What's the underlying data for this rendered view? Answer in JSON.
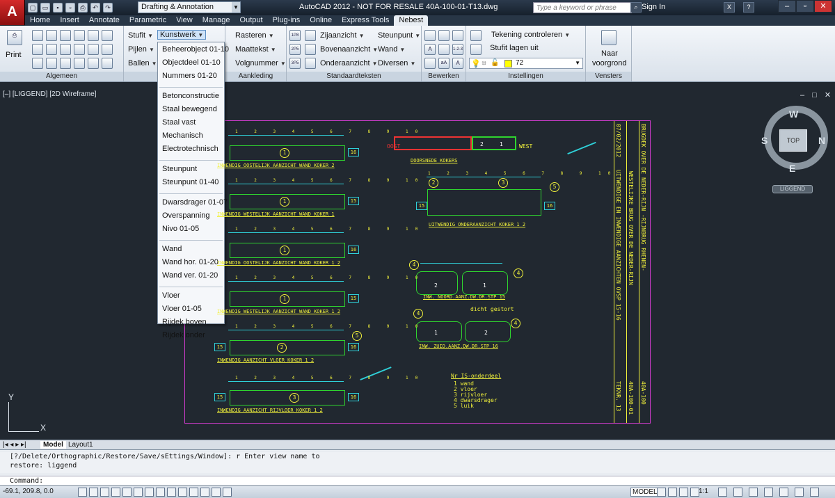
{
  "titlebar": {
    "logo": "A",
    "workspace": "Drafting & Annotation",
    "app_title": "AutoCAD 2012 - NOT FOR RESALE   40A-100-01-T13.dwg",
    "search_placeholder": "Type a keyword or phrase",
    "sign_in": "Sign In"
  },
  "tabs": [
    "Home",
    "Insert",
    "Annotate",
    "Parametric",
    "View",
    "Manage",
    "Output",
    "Plug-ins",
    "Online",
    "Express Tools",
    "Nebest"
  ],
  "active_tab": "Nebest",
  "ribbon": {
    "algemeen": {
      "title": "Algemeen",
      "print": "Print"
    },
    "b_panel": {
      "title": "B",
      "stufit": "Stufit",
      "pijlen": "Pijlen",
      "ballen": "Ballen",
      "kunstwerk": "Kunstwerk"
    },
    "aankleding": {
      "title": "Aankleding",
      "rasteren": "Rasteren",
      "maattekst": "Maattekst",
      "volgnummer": "Volgnummer"
    },
    "standaardteksten": {
      "title": "Standaardteksten",
      "zijaanzicht": "Zijaanzicht",
      "bovenaanzicht": "Bovenaanzicht",
      "onderaanzicht": "Onderaanzicht",
      "steunpunt": "Steunpunt",
      "wand": "Wand",
      "diversen": "Diversen"
    },
    "bewerken": {
      "title": "Bewerken"
    },
    "instellingen": {
      "title": "Instellingen",
      "tekening": "Tekening controleren",
      "stufit_lagen": "Stufit lagen uit",
      "layer_value": "72"
    },
    "vensters": {
      "title": "Vensters",
      "naar": "Naar",
      "voorgrond": "voorgrond"
    }
  },
  "dropdown": {
    "items": [
      "Beheerobject 01-10",
      "Objectdeel 01-10",
      "Nummers 01-20",
      "Betonconstructie",
      "Staal bewegend",
      "Staal vast",
      "Mechanisch",
      "Electrotechnisch",
      "Steunpunt",
      "Steunpunt 01-40",
      "Dwarsdrager 01-07",
      "Overspanning",
      "Nivo 01-05",
      "Wand",
      "Wand hor. 01-20",
      "Wand ver. 01-20",
      "Vloer",
      "Vloer 01-05",
      "Rijdek boven",
      "Rijdek onder"
    ]
  },
  "viewport": {
    "label": "[–] [LIGGEND] [2D Wireframe]",
    "controls": "– □ ✕",
    "compass": {
      "n": "W",
      "e": "N",
      "s": "E",
      "w": "S",
      "top": "TOP"
    },
    "wcs": "LIGGEND",
    "ucs_y": "Y",
    "ucs_x": "X"
  },
  "drawing": {
    "labels": [
      "INWENDIG OOSTELIJK AANZICHT WAND KOKER 2",
      "INWENDIG WESTELIJK AANZICHT WAND KOKER 1",
      "INWENDIG OOSTELIJK AANZICHT WAND KOKER 1 2",
      "INWENDIG WESTELIJK AANZICHT WAND KOKER 1 2",
      "INWENDIG AANZICHT VLOER KOKER 1 2",
      "INWENDIG AANZICHT RIJVLOER KOKER 1 2",
      "DOORSNEDE KOKERS",
      "UITWENDIG ONDERAANZICHT KOKER 1 2",
      "INW. NOORD.AANZ.DW.DR.STP 15",
      "INW. ZUID.AANZ.DW.DR.STP 16"
    ],
    "oost": "OOST",
    "west": "WEST",
    "dicht": "dicht gestort",
    "legend_header": "Nr  IS-onderdeel",
    "legend": [
      "1 wand",
      "2 vloer",
      "3 rijvloer",
      "4 dwarsdrager",
      "5 luik"
    ],
    "title_col1": "BRUGDEK OVER DE NEDER-RIJN -RIJNBRUG RHENEN-",
    "title_col2": "WESTELIJKE BRUG OVER DE NEDER-RIJN",
    "title_col3": "UITWENDIGE EN INWENDIGE AANZICHTEN OVSP 15-16",
    "date": "07/02/2012",
    "code1": "40A-100",
    "code2": "40A-100-01",
    "tekn": "TEKNR. 13",
    "dim_numbers": "1 2 3 4 5 6 7 8 9 10"
  },
  "layout_tabs": [
    "Model",
    "Layout1"
  ],
  "command": {
    "history1": "[?/Delete/Orthographic/Restore/Save/sEttings/Window]: r Enter view name to",
    "history2": "restore: liggend",
    "prompt": "Command:"
  },
  "status": {
    "coords": "-69.1, 209.8, 0.0",
    "model": "MODEL",
    "scale": "1:1"
  }
}
